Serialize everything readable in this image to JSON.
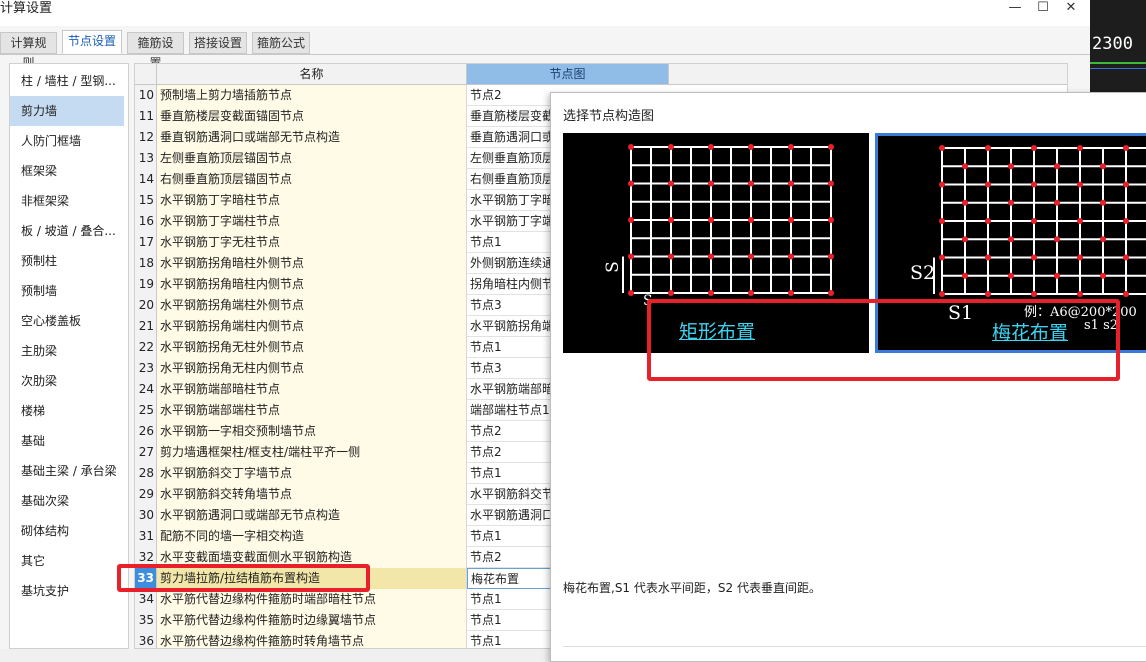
{
  "window": {
    "title": "计算设置",
    "min": "—",
    "max": "☐",
    "close": "✕"
  },
  "tabs": [
    "计算规则",
    "节点设置",
    "箍筋设置",
    "搭接设置",
    "箍筋公式"
  ],
  "active_tab": 1,
  "sidebar": {
    "items": [
      "柱 / 墙柱 / 型钢...",
      "剪力墙",
      "人防门框墙",
      "框架梁",
      "非框架梁",
      "板 / 坡道 / 叠合...",
      "预制柱",
      "预制墙",
      "空心楼盖板",
      "主肋梁",
      "次肋梁",
      "楼梯",
      "基础",
      "基础主梁 / 承台梁",
      "基础次梁",
      "砌体结构",
      "其它",
      "基坑支护"
    ],
    "active": 1
  },
  "grid": {
    "headers": [
      "名称",
      "节点图"
    ],
    "rows": [
      {
        "num": "10",
        "name": "预制墙上剪力墙插筋节点",
        "node": "节点2"
      },
      {
        "num": "11",
        "name": "垂直筋楼层变截面锚固节点",
        "node": "垂直筋楼层变截"
      },
      {
        "num": "12",
        "name": "垂直钢筋遇洞口或端部无节点构造",
        "node": "垂直筋遇洞口或"
      },
      {
        "num": "13",
        "name": "左侧垂直筋顶层锚固节点",
        "node": "左侧垂直筋顶层"
      },
      {
        "num": "14",
        "name": "右侧垂直筋顶层锚固节点",
        "node": "右侧垂直筋顶层"
      },
      {
        "num": "15",
        "name": "水平钢筋丁字暗柱节点",
        "node": "水平钢筋丁字暗"
      },
      {
        "num": "16",
        "name": "水平钢筋丁字端柱节点",
        "node": "水平钢筋丁字端"
      },
      {
        "num": "17",
        "name": "水平钢筋丁字无柱节点",
        "node": "节点1"
      },
      {
        "num": "18",
        "name": "水平钢筋拐角暗柱外侧节点",
        "node": "外侧钢筋连续通"
      },
      {
        "num": "19",
        "name": "水平钢筋拐角暗柱内侧节点",
        "node": "拐角暗柱内侧节"
      },
      {
        "num": "20",
        "name": "水平钢筋拐角端柱外侧节点",
        "node": "节点3"
      },
      {
        "num": "21",
        "name": "水平钢筋拐角端柱内侧节点",
        "node": "水平钢筋拐角端"
      },
      {
        "num": "22",
        "name": "水平钢筋拐角无柱外侧节点",
        "node": "节点1"
      },
      {
        "num": "23",
        "name": "水平钢筋拐角无柱内侧节点",
        "node": "节点3"
      },
      {
        "num": "24",
        "name": "水平钢筋端部暗柱节点",
        "node": "水平钢筋端部暗"
      },
      {
        "num": "25",
        "name": "水平钢筋端部端柱节点",
        "node": "端部端柱节点1"
      },
      {
        "num": "26",
        "name": "水平钢筋一字相交预制墙节点",
        "node": "节点2"
      },
      {
        "num": "27",
        "name": "剪力墙遇框架柱/框支柱/端柱平齐一侧",
        "node": "节点2"
      },
      {
        "num": "28",
        "name": "水平钢筋斜交丁字墙节点",
        "node": "节点1"
      },
      {
        "num": "29",
        "name": "水平钢筋斜交转角墙节点",
        "node": "水平钢筋斜交节"
      },
      {
        "num": "30",
        "name": "水平钢筋遇洞口或端部无节点构造",
        "node": "水平钢筋遇洞口"
      },
      {
        "num": "31",
        "name": "配筋不同的墙一字相交构造",
        "node": "节点1"
      },
      {
        "num": "32",
        "name": "水平变截面墙变截面侧水平钢筋构造",
        "node": "节点2"
      },
      {
        "num": "33",
        "name": "剪力墙拉筋/拉结植筋布置构造",
        "node": "梅花布置"
      },
      {
        "num": "34",
        "name": "水平筋代替边缘构件箍筋时端部暗柱节点",
        "node": "节点1"
      },
      {
        "num": "35",
        "name": "水平筋代替边缘构件箍筋时边缘翼墙节点",
        "node": "节点1"
      },
      {
        "num": "36",
        "name": "水平筋代替边缘构件箍筋时转角墙节点",
        "node": "节点1"
      }
    ],
    "selected_row": 23
  },
  "popup": {
    "title": "选择节点构造图",
    "options": [
      {
        "caption": "矩形布置",
        "label_s": "S",
        "label_s1": "S"
      },
      {
        "caption": "梅花布置",
        "label_s": "S2",
        "label_s1": "S1",
        "note": "例：A6@200*200",
        "note2": "s1 s2"
      }
    ],
    "selected_option": 1,
    "description": "梅花布置,S1 代表水平间距，S2 代表垂直间距。"
  },
  "background": {
    "value": "2300"
  },
  "colors": {
    "accent": "#3e8ede",
    "highlight": "#e8202a",
    "grid_line": "#ffffff",
    "dot": "#e8202a",
    "caption": "#3bd4f0"
  }
}
